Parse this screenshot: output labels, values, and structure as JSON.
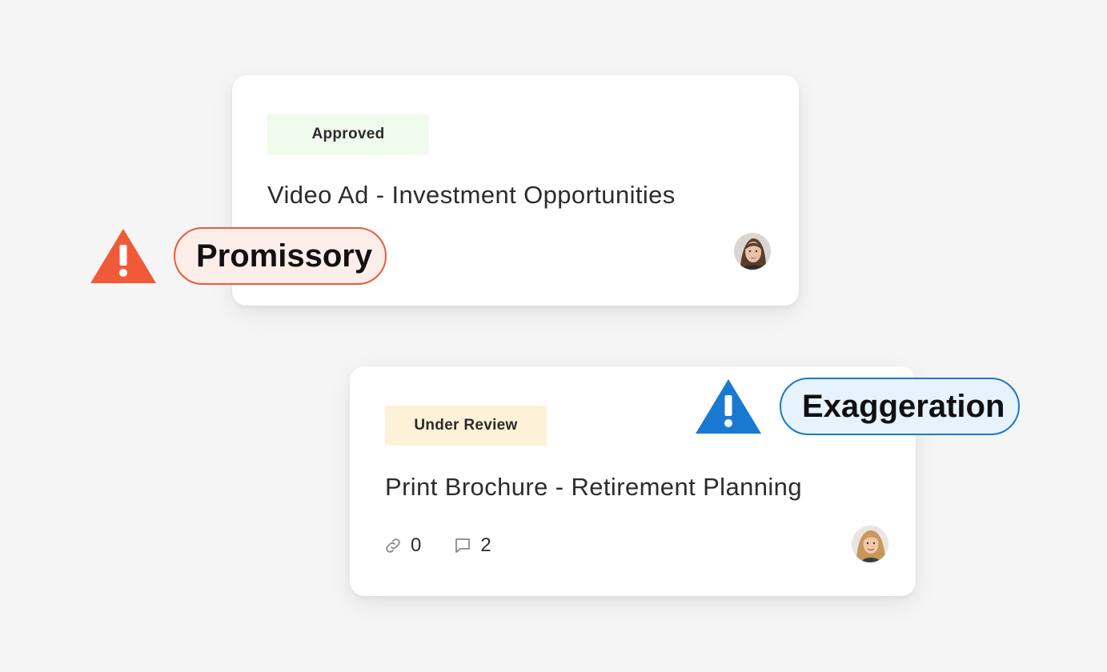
{
  "colors": {
    "background": "#f5f5f5",
    "card": "#ffffff",
    "approved_bg": "#effbec",
    "review_bg": "#fdf2d8",
    "warning_red": "#f05a38",
    "warning_blue": "#1a79d1"
  },
  "cards": [
    {
      "status": "Approved",
      "title": "Video Ad - Investment Opportunities",
      "avatar_icon": "user-avatar"
    },
    {
      "status": "Under Review",
      "title": "Print Brochure - Retirement Planning",
      "links_count": "0",
      "comments_count": "2",
      "link_icon": "link-icon",
      "comment_icon": "comment-icon",
      "avatar_icon": "user-avatar"
    }
  ],
  "flags": [
    {
      "label": "Promissory",
      "icon": "warning-icon",
      "color": "red"
    },
    {
      "label": "Exaggeration",
      "icon": "warning-icon",
      "color": "blue"
    }
  ]
}
